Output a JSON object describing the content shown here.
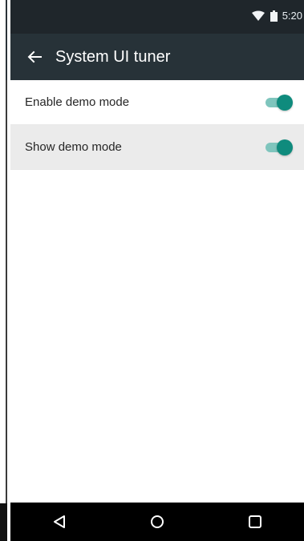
{
  "status_bar": {
    "time": "5:20",
    "wifi_icon": "wifi-icon",
    "battery_icon": "battery-icon"
  },
  "app_bar": {
    "back_icon": "back-arrow-icon",
    "title": "System UI tuner",
    "background": "#273238"
  },
  "settings": {
    "items": [
      {
        "label": "Enable demo mode",
        "toggle_on": true,
        "selected": false
      },
      {
        "label": "Show demo mode",
        "toggle_on": true,
        "selected": true
      }
    ],
    "accent": "#0f8b7d"
  },
  "nav_bar": {
    "back_icon": "nav-back-icon",
    "home_icon": "nav-home-icon",
    "recents_icon": "nav-recents-icon"
  }
}
